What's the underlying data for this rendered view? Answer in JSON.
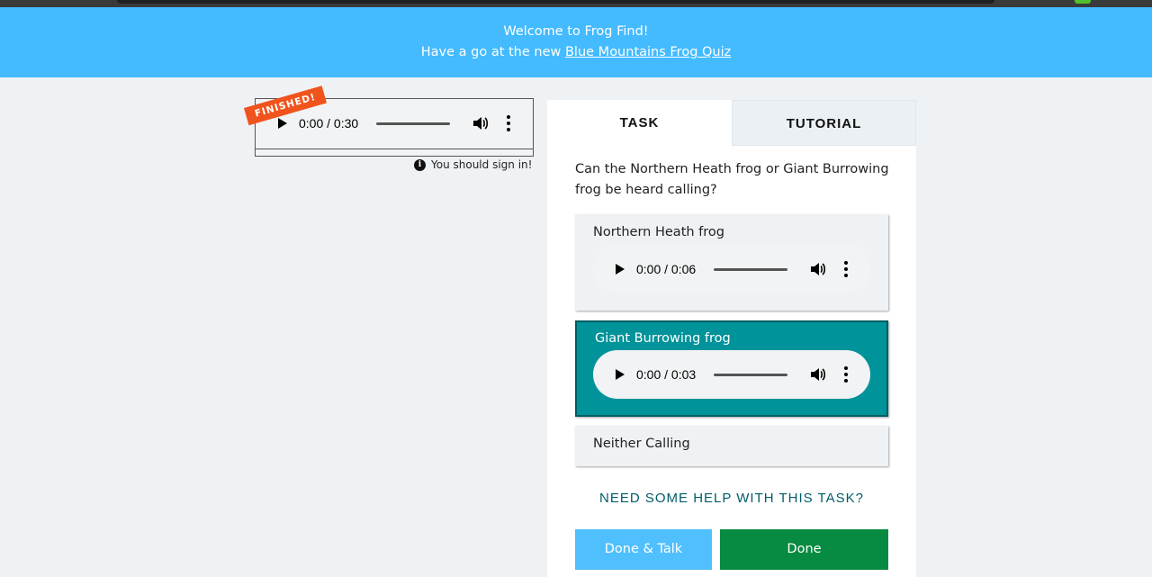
{
  "banner": {
    "line1": "Welcome to Frog Find!",
    "line2_prefix": "Have a go at the new",
    "line2_link": "Blue Mountains Frog Quiz"
  },
  "subject": {
    "ribbon": "FINISHED!",
    "player": {
      "time": "0:00 / 0:30"
    },
    "signin_notice": "You should sign in!",
    "info_icon": "info-icon"
  },
  "tabs": [
    {
      "label": "TASK",
      "active": true
    },
    {
      "label": "TUTORIAL",
      "active": false
    }
  ],
  "task": {
    "question": "Can the Northern Heath frog or Giant Burrowing frog be heard calling?",
    "answers": [
      {
        "label": "Northern Heath frog",
        "time": "0:00 / 0:06",
        "selected": false
      },
      {
        "label": "Giant Burrowing frog",
        "time": "0:00 / 0:03",
        "selected": true
      },
      {
        "label": "Neither Calling",
        "selected": false
      }
    ],
    "help": "NEED SOME HELP WITH THIS TASK?",
    "done_talk": "Done & Talk",
    "done": "Done"
  },
  "colors": {
    "banner": "#43bbfe",
    "selected": "#009399",
    "ribbon": "#f0531c",
    "done": "#078a41",
    "done_talk": "#50bffd",
    "help_text": "#005d69"
  },
  "icons": [
    "play-icon",
    "volume-icon",
    "more-vertical-icon",
    "info-icon"
  ]
}
